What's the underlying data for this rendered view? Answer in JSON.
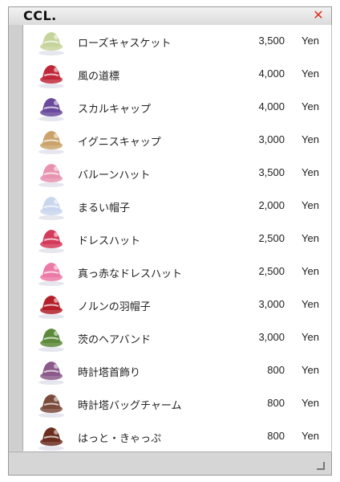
{
  "window": {
    "title": "CCL.",
    "close_symbol": "✕"
  },
  "colors": {
    "close": "#e0301e",
    "text": "#222222",
    "panel": "#d9d9d9"
  },
  "items": [
    {
      "name": "ローズキャスケット",
      "price": "3,500",
      "currency": "Yen",
      "icon": "rose-casquette-hat-icon",
      "color": "#c5d49a"
    },
    {
      "name": "風の道標",
      "price": "4,000",
      "currency": "Yen",
      "icon": "wind-signpost-icon",
      "color": "#c0283a"
    },
    {
      "name": "スカルキャップ",
      "price": "4,000",
      "currency": "Yen",
      "icon": "skull-cap-icon",
      "color": "#6a4a9c"
    },
    {
      "name": "イグニスキャップ",
      "price": "3,000",
      "currency": "Yen",
      "icon": "ignis-cap-icon",
      "color": "#c9a36a"
    },
    {
      "name": "バルーンハット",
      "price": "3,500",
      "currency": "Yen",
      "icon": "balloon-hat-icon",
      "color": "#e893b0"
    },
    {
      "name": "まるい帽子",
      "price": "2,000",
      "currency": "Yen",
      "icon": "round-hat-icon",
      "color": "#c9d6ee"
    },
    {
      "name": "ドレスハット",
      "price": "2,500",
      "currency": "Yen",
      "icon": "dress-hat-icon",
      "color": "#d43a5a"
    },
    {
      "name": "真っ赤なドレスハット",
      "price": "2,500",
      "currency": "Yen",
      "icon": "red-dress-hat-icon",
      "color": "#ec7aa6"
    },
    {
      "name": "ノルンの羽帽子",
      "price": "3,000",
      "currency": "Yen",
      "icon": "norn-feather-hat-icon",
      "color": "#b3202a"
    },
    {
      "name": "茨のヘアバンド",
      "price": "3,000",
      "currency": "Yen",
      "icon": "thorn-hairband-icon",
      "color": "#5a8a3a"
    },
    {
      "name": "時計塔首飾り",
      "price": "800",
      "currency": "Yen",
      "icon": "clocktower-necklace-icon",
      "color": "#8a5a8a"
    },
    {
      "name": "時計塔バッグチャーム",
      "price": "800",
      "currency": "Yen",
      "icon": "clocktower-bag-charm-icon",
      "color": "#7a4a3a"
    },
    {
      "name": "はっと・きゃっぷ",
      "price": "800",
      "currency": "Yen",
      "icon": "hat-cap-icon",
      "color": "#6b2e1e"
    }
  ]
}
